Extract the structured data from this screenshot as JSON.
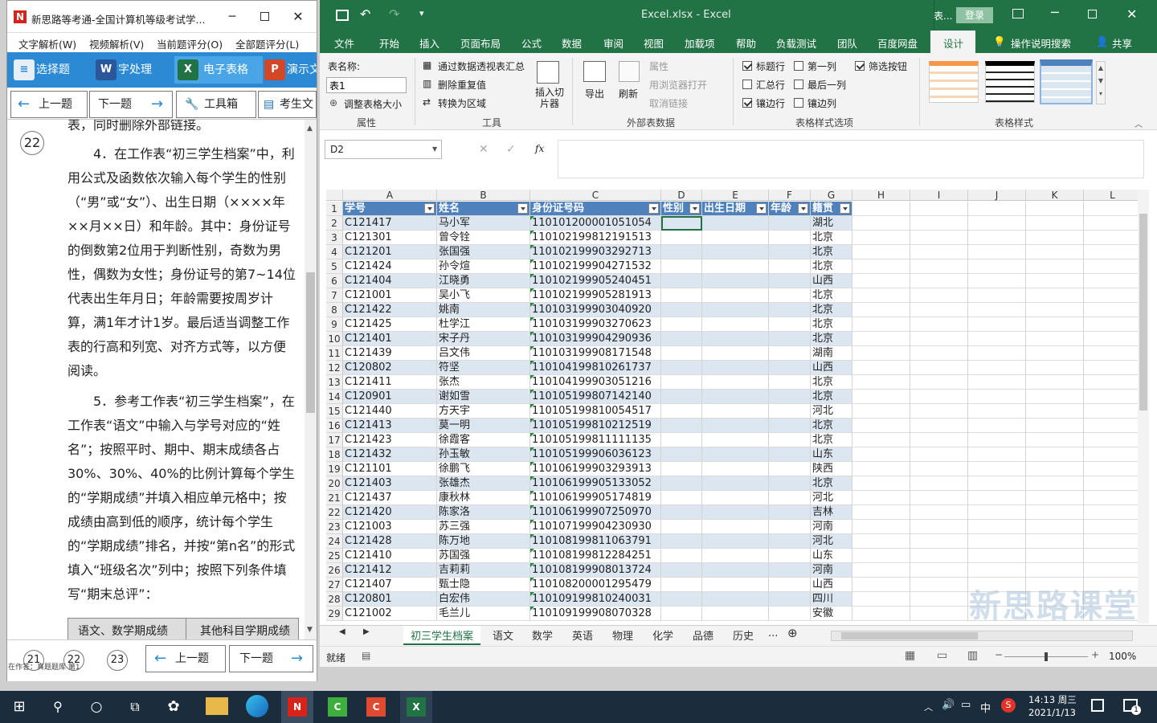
{
  "left_app": {
    "title": "新思路等考通-全国计算机等级考试学...",
    "menu": [
      "文字解析(W)",
      "视频解析(V)",
      "当前题评分(O)",
      "全部题评分(L)"
    ],
    "toolbar": [
      "选择题",
      "字处理",
      "电子表格",
      "演示文"
    ],
    "nav": {
      "prev": "上一题",
      "next": "下一题",
      "toolbox": "工具箱",
      "exam": "考生文"
    },
    "question_no": "22",
    "partial_top": "表，同时删除外部链接。",
    "para4": "4．在工作表“初三学生档案”中，利用公式及函数依次输入每个学生的性别（“男”或“女”）、出生日期（××××年××月××日）和年龄。其中：身份证号的倒数第2位用于判断性别，奇数为男性，偶数为女性；身份证号的第7~14位代表出生年月日；年龄需要按周岁计算，满1年才计1岁。最后适当调整工作表的行高和列宽、对齐方式等，以方便阅读。",
    "para5": "5．参考工作表“初三学生档案”，在工作表“语文”中输入与学号对应的“姓名”；按照平时、期中、期末成绩各占30%、30%、40%的比例计算每个学生的“学期成绩”并填入相应单元格中；按成绩由高到低的顺序，统计每个学生的“学期成绩”排名，并按“第n名”的形式填入“班级名次”列中；按照下列条件填写“期末总评”：",
    "table_headers": [
      "语文、数学期成绩",
      "其他科目学期成绩"
    ],
    "bottom": {
      "pages": [
        "21",
        "22",
        "23"
      ],
      "prev": "上一题",
      "next": "下一题",
      "status": "在作答：真题题库 第1"
    }
  },
  "excel": {
    "title": "Excel.xlsx - Excel",
    "title_right": "表...",
    "login": "登录",
    "tabs": [
      "文件",
      "开始",
      "插入",
      "页面布局",
      "公式",
      "数据",
      "审阅",
      "视图",
      "加载项",
      "帮助",
      "负载测试",
      "团队",
      "百度网盘",
      "设计",
      "操作说明搜索",
      "共享"
    ],
    "ribbon": {
      "table_name_label": "表名称:",
      "table_name_value": "表1",
      "resize": "调整表格大小",
      "group_props": "属性",
      "pivot": "通过数据透视表汇总",
      "remove_dup": "删除重复值",
      "convert": "转换为区域",
      "slicer": "插入切片器",
      "group_tools": "工具",
      "export": "导出",
      "refresh": "刷新",
      "prop": "属性",
      "open_browser": "用浏览器打开",
      "unlink": "取消链接",
      "group_external": "外部表数据",
      "opt_header": "标题行",
      "opt_total": "汇总行",
      "opt_banded_rows": "镶边行",
      "opt_first_col": "第一列",
      "opt_last_col": "最后一列",
      "opt_banded_cols": "镶边列",
      "opt_filter": "筛选按钮",
      "group_style_opts": "表格样式选项",
      "group_styles": "表格样式"
    },
    "namebox": "D2",
    "fx": "fx",
    "col_letters": [
      "A",
      "B",
      "C",
      "D",
      "E",
      "F",
      "G",
      "H",
      "I",
      "J",
      "K",
      "L"
    ],
    "headers": [
      "学号",
      "姓名",
      "身份证号码",
      "性别",
      "出生日期",
      "年龄",
      "籍贯"
    ],
    "rows": [
      [
        "C121417",
        "马小军",
        "110101200001051054",
        "湖北"
      ],
      [
        "C121301",
        "曾令铨",
        "110102199812191513",
        "北京"
      ],
      [
        "C121201",
        "张国强",
        "110102199903292713",
        "北京"
      ],
      [
        "C121424",
        "孙令煊",
        "110102199904271532",
        "北京"
      ],
      [
        "C121404",
        "江晓勇",
        "110102199905240451",
        "山西"
      ],
      [
        "C121001",
        "吴小飞",
        "110102199905281913",
        "北京"
      ],
      [
        "C121422",
        "姚南",
        "110103199903040920",
        "北京"
      ],
      [
        "C121425",
        "杜学江",
        "110103199903270623",
        "北京"
      ],
      [
        "C121401",
        "宋子丹",
        "110103199904290936",
        "北京"
      ],
      [
        "C121439",
        "吕文伟",
        "110103199908171548",
        "湖南"
      ],
      [
        "C120802",
        "符坚",
        "110104199810261737",
        "山西"
      ],
      [
        "C121411",
        "张杰",
        "110104199903051216",
        "北京"
      ],
      [
        "C120901",
        "谢如雪",
        "110105199807142140",
        "北京"
      ],
      [
        "C121440",
        "方天宇",
        "110105199810054517",
        "河北"
      ],
      [
        "C121413",
        "莫一明",
        "110105199810212519",
        "北京"
      ],
      [
        "C121423",
        "徐霞客",
        "110105199811111135",
        "北京"
      ],
      [
        "C121432",
        "孙玉敏",
        "110105199906036123",
        "山东"
      ],
      [
        "C121101",
        "徐鹏飞",
        "110106199903293913",
        "陕西"
      ],
      [
        "C121403",
        "张雄杰",
        "110106199905133052",
        "北京"
      ],
      [
        "C121437",
        "康秋林",
        "110106199905174819",
        "河北"
      ],
      [
        "C121420",
        "陈家洛",
        "110106199907250970",
        "吉林"
      ],
      [
        "C121003",
        "苏三强",
        "110107199904230930",
        "河南"
      ],
      [
        "C121428",
        "陈万地",
        "110108199811063791",
        "河北"
      ],
      [
        "C121410",
        "苏国强",
        "110108199812284251",
        "山东"
      ],
      [
        "C121412",
        "吉莉莉",
        "110108199908013724",
        "河南"
      ],
      [
        "C121407",
        "甄士隐",
        "110108200001295479",
        "山西"
      ],
      [
        "C120801",
        "白宏伟",
        "110109199810240031",
        "四川"
      ],
      [
        "C121002",
        "毛兰儿",
        "110109199908070328",
        "安徽"
      ]
    ],
    "sheets": [
      "初三学生档案",
      "语文",
      "数学",
      "英语",
      "物理",
      "化学",
      "品德",
      "历史",
      "..."
    ],
    "status": {
      "ready": "就绪",
      "zoom": "100%"
    },
    "watermark": "新思路课堂"
  },
  "taskbar": {
    "time": "14:13 周三",
    "date": "2021/1/13",
    "ime": "中",
    "notif": "1"
  },
  "colors": {
    "excel_green": "#217346",
    "table_header": "#4f81bd",
    "band": "#dce6f1",
    "left_blue": "#2b8ad3"
  }
}
